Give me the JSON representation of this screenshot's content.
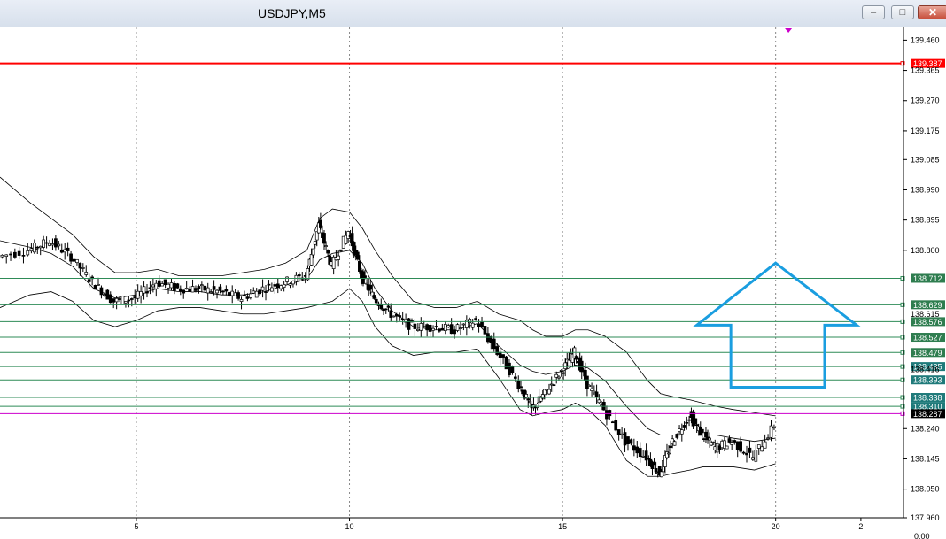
{
  "window": {
    "title": "USDJPY,M5",
    "buttons": [
      {
        "name": "minimize-button",
        "glyph": "–"
      },
      {
        "name": "restore-button",
        "glyph": "□"
      },
      {
        "name": "close-button",
        "glyph": "✕"
      }
    ]
  },
  "chart_data": {
    "type": "candlestick",
    "symbol": "USDJPY",
    "timeframe": "M5",
    "ylim": [
      137.96,
      139.5
    ],
    "y_ticks": [
      "139.460",
      "139.365",
      "139.270",
      "139.175",
      "139.085",
      "138.990",
      "138.895",
      "138.800",
      "138.240",
      "138.145",
      "138.050",
      "137.960"
    ],
    "x_ticks": [
      "5",
      "10",
      "15",
      "20",
      "2"
    ],
    "x_tick_values": [
      5,
      10,
      15,
      20,
      22
    ],
    "x_range": [
      1.8,
      23.0
    ],
    "bottom_right_label": "0.00",
    "colors": {
      "resistance": "#ff0000",
      "level": "#2e8b57",
      "current": "#cc00cc",
      "tag_green": "#2e7d4f",
      "tag_teal": "#1f7a7a",
      "arrow": "#1a9ee0"
    },
    "levels": [
      {
        "price": 139.387,
        "label": "139.387",
        "style": "resistance"
      },
      {
        "price": 138.712,
        "label": "138.712",
        "style": "level"
      },
      {
        "price": 138.629,
        "label": "138.629",
        "style": "level"
      },
      {
        "price": 138.576,
        "label": "138.576",
        "style": "level"
      },
      {
        "price": 138.527,
        "label": "138.527",
        "style": "level"
      },
      {
        "price": 138.479,
        "label": "138.479",
        "style": "level"
      },
      {
        "price": 138.435,
        "label": "138.435",
        "style": "teal"
      },
      {
        "price": 138.393,
        "label": "138.393",
        "style": "teal"
      },
      {
        "price": 138.338,
        "label": "138.338",
        "style": "teal"
      },
      {
        "price": 138.31,
        "label": "138.310",
        "style": "teal"
      },
      {
        "price": 138.287,
        "label": "138.287",
        "style": "current"
      }
    ],
    "hidden_labels": [
      "138.615",
      "138.416"
    ],
    "series": [
      {
        "name": "close",
        "x": [
          1.8,
          2.5,
          3.0,
          3.5,
          4.0,
          4.5,
          5.0,
          5.5,
          6.0,
          6.5,
          7.0,
          7.5,
          8.0,
          8.5,
          9.0,
          9.3,
          9.6,
          10.0,
          10.3,
          10.6,
          11.0,
          11.5,
          12.0,
          12.5,
          13.0,
          13.5,
          14.0,
          14.3,
          14.6,
          15.0,
          15.3,
          15.6,
          16.0,
          16.5,
          17.0,
          17.3,
          17.6,
          18.0,
          18.3,
          18.6,
          19.0,
          19.5,
          20.0
        ],
        "values": [
          138.78,
          138.8,
          138.83,
          138.78,
          138.7,
          138.64,
          138.65,
          138.7,
          138.68,
          138.68,
          138.67,
          138.65,
          138.68,
          138.7,
          138.72,
          138.88,
          138.75,
          138.86,
          138.72,
          138.65,
          138.6,
          138.56,
          138.56,
          138.55,
          138.58,
          138.48,
          138.38,
          138.3,
          138.35,
          138.42,
          138.48,
          138.38,
          138.3,
          138.2,
          138.15,
          138.1,
          138.2,
          138.28,
          138.22,
          138.18,
          138.2,
          138.15,
          138.25
        ]
      }
    ],
    "bands": [
      {
        "name": "upper",
        "values": [
          139.03,
          138.95,
          138.9,
          138.85,
          138.78,
          138.73,
          138.73,
          138.74,
          138.72,
          138.72,
          138.72,
          138.73,
          138.74,
          138.76,
          138.8,
          138.9,
          138.93,
          138.92,
          138.87,
          138.8,
          138.72,
          138.64,
          138.62,
          138.62,
          138.64,
          138.6,
          138.58,
          138.55,
          138.53,
          138.53,
          138.55,
          138.55,
          138.53,
          138.48,
          138.39,
          138.35,
          138.34,
          138.33,
          138.32,
          138.31,
          138.3,
          138.29,
          138.28
        ]
      },
      {
        "name": "lower",
        "values": [
          138.62,
          138.66,
          138.67,
          138.64,
          138.58,
          138.56,
          138.58,
          138.61,
          138.62,
          138.62,
          138.61,
          138.6,
          138.6,
          138.61,
          138.62,
          138.63,
          138.64,
          138.68,
          138.64,
          138.56,
          138.5,
          138.47,
          138.48,
          138.48,
          138.49,
          138.4,
          138.3,
          138.28,
          138.29,
          138.3,
          138.32,
          138.3,
          138.25,
          138.14,
          138.09,
          138.09,
          138.1,
          138.11,
          138.12,
          138.12,
          138.12,
          138.11,
          138.13
        ]
      },
      {
        "name": "middle",
        "values": [
          138.83,
          138.81,
          138.79,
          138.75,
          138.68,
          138.65,
          138.66,
          138.68,
          138.67,
          138.67,
          138.66,
          138.66,
          138.67,
          138.69,
          138.71,
          138.77,
          138.79,
          138.8,
          138.76,
          138.68,
          138.61,
          138.56,
          138.55,
          138.55,
          138.57,
          138.5,
          138.44,
          138.42,
          138.41,
          138.42,
          138.44,
          138.43,
          138.39,
          138.31,
          138.24,
          138.22,
          138.22,
          138.22,
          138.22,
          138.22,
          138.21,
          138.2,
          138.21
        ]
      }
    ],
    "annotation": {
      "type": "up-arrow",
      "color": "#1a9ee0"
    },
    "marker": {
      "type": "triangle-down",
      "color": "#cc00cc",
      "x": 20.3
    }
  }
}
